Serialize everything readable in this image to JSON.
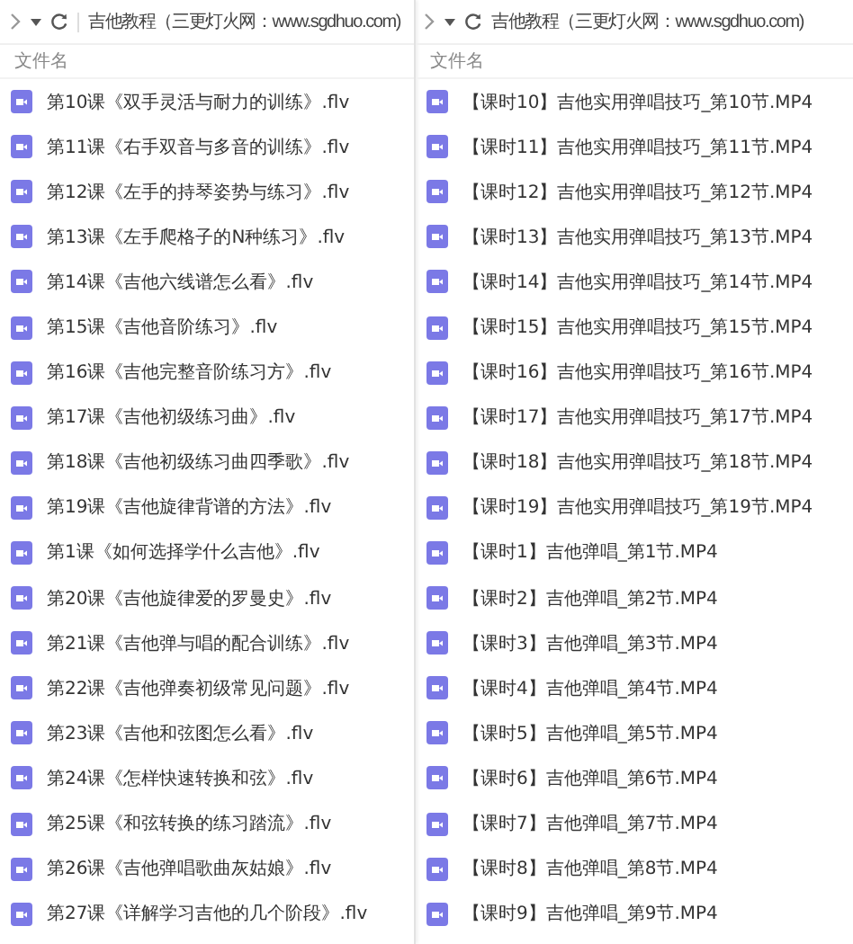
{
  "panels": [
    {
      "title": "吉他教程（三更灯火网：www.sgdhuo.com)",
      "column_header": "文件名",
      "files": [
        "第10课《双手灵活与耐力的训练》.flv",
        "第11课《右手双音与多音的训练》.flv",
        "第12课《左手的持琴姿势与练习》.flv",
        "第13课《左手爬格子的N种练习》.flv",
        "第14课《吉他六线谱怎么看》.flv",
        "第15课《吉他音阶练习》.flv",
        "第16课《吉他完整音阶练习方》.flv",
        "第17课《吉他初级练习曲》.flv",
        "第18课《吉他初级练习曲四季歌》.flv",
        "第19课《吉他旋律背谱的方法》.flv",
        "第1课《如何选择学什么吉他》.flv",
        "第20课《吉他旋律爱的罗曼史》.flv",
        "第21课《吉他弹与唱的配合训练》.flv",
        "第22课《吉他弹奏初级常见问题》.flv",
        "第23课《吉他和弦图怎么看》.flv",
        "第24课《怎样快速转换和弦》.flv",
        "第25课《和弦转换的练习踏流》.flv",
        "第26课《吉他弹唱歌曲灰姑娘》.flv",
        "第27课《详解学习吉他的几个阶段》.flv"
      ]
    },
    {
      "title": "吉他教程（三更灯火网：www.sgdhuo.com)",
      "column_header": "文件名",
      "files": [
        "【课时10】吉他实用弹唱技巧_第10节.MP4",
        "【课时11】吉他实用弹唱技巧_第11节.MP4",
        "【课时12】吉他实用弹唱技巧_第12节.MP4",
        "【课时13】吉他实用弹唱技巧_第13节.MP4",
        "【课时14】吉他实用弹唱技巧_第14节.MP4",
        "【课时15】吉他实用弹唱技巧_第15节.MP4",
        "【课时16】吉他实用弹唱技巧_第16节.MP4",
        "【课时17】吉他实用弹唱技巧_第17节.MP4",
        "【课时18】吉他实用弹唱技巧_第18节.MP4",
        "【课时19】吉他实用弹唱技巧_第19节.MP4",
        "【课时1】吉他弹唱_第1节.MP4",
        "【课时2】吉他弹唱_第2节.MP4",
        "【课时3】吉他弹唱_第3节.MP4",
        "【课时4】吉他弹唱_第4节.MP4",
        "【课时5】吉他弹唱_第5节.MP4",
        "【课时6】吉他弹唱_第6节.MP4",
        "【课时7】吉他弹唱_第7节.MP4",
        "【课时8】吉他弹唱_第8节.MP4",
        "【课时9】吉他弹唱_第9节.MP4"
      ]
    }
  ]
}
